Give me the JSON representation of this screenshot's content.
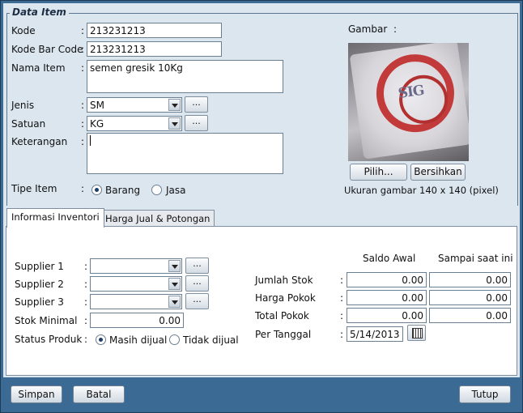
{
  "group_title": "Data Item",
  "fields": {
    "kode_label": "Kode",
    "kode_value": "213231213",
    "barcode_label": "Kode Bar Code",
    "barcode_value": "213231213",
    "nama_label": "Nama Item",
    "nama_value": "semen gresik 10Kg",
    "jenis_label": "Jenis",
    "jenis_value": "SM",
    "satuan_label": "Satuan",
    "satuan_value": "KG",
    "keterangan_label": "Keterangan",
    "keterangan_value": "",
    "tipe_label": "Tipe Item",
    "tipe_options": [
      "Barang",
      "Jasa"
    ],
    "tipe_selected": "Barang",
    "colon": ":",
    "dots": "..."
  },
  "gambar": {
    "label": "Gambar",
    "colon": ":",
    "pilih_button": "Pilih...",
    "bersihkan_button": "Bersihkan",
    "size_note": "Ukuran gambar 140 x 140 (pixel)"
  },
  "tabs": [
    {
      "label": "Informasi Inventori",
      "active": true
    },
    {
      "label": "Harga Jual & Potongan",
      "active": false
    }
  ],
  "inventori": {
    "supplier1_label": "Supplier 1",
    "supplier2_label": "Supplier 2",
    "supplier3_label": "Supplier 3",
    "stok_minimal_label": "Stok Minimal",
    "stok_minimal_value": "0.00",
    "status_label": "Status Produk",
    "status_options": [
      "Masih dijual",
      "Tidak dijual"
    ],
    "status_selected": "Masih dijual",
    "col_saldo_awal": "Saldo Awal",
    "col_sampai": "Sampai saat ini",
    "jumlah_stok_label": "Jumlah Stok",
    "harga_pokok_label": "Harga Pokok",
    "total_pokok_label": "Total Pokok",
    "per_tanggal_label": "Per Tanggal",
    "jumlah_stok_awal": "0.00",
    "jumlah_stok_kini": "0.00",
    "harga_pokok_awal": "0.00",
    "harga_pokok_kini": "0.00",
    "total_pokok_awal": "0.00",
    "total_pokok_kini": "0.00",
    "per_tanggal_value": "5/14/2013"
  },
  "footer": {
    "simpan": "Simpan",
    "batal": "Batal",
    "tutup": "Tutup"
  },
  "colors": {
    "frame": "#3b6a95",
    "panel": "#dbe6ef"
  },
  "image_logo_text": "SIG"
}
